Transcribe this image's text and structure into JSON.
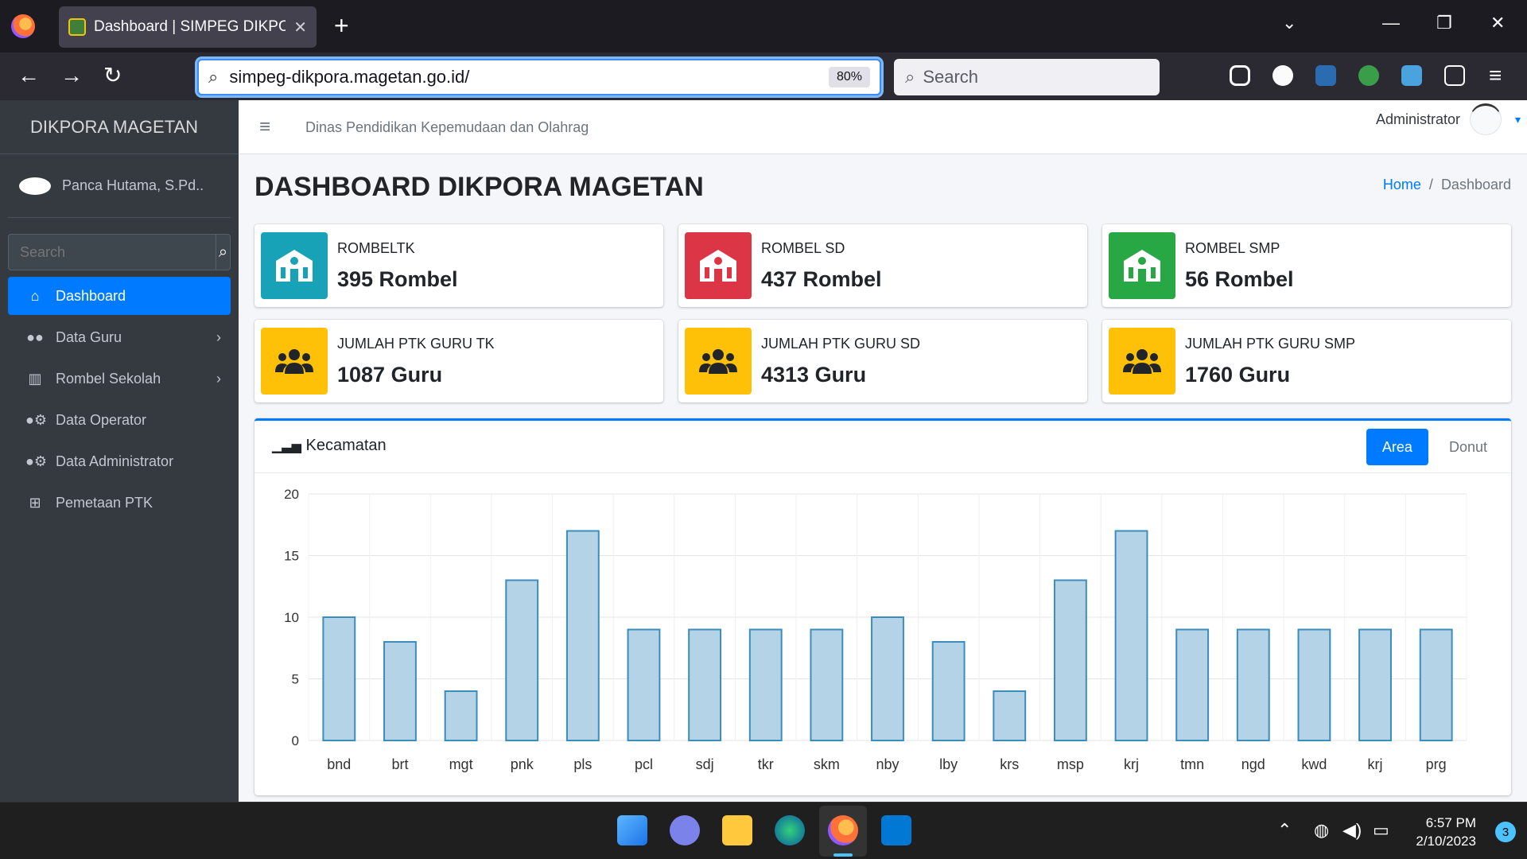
{
  "browser": {
    "tab_title": "Dashboard | SIMPEG DIKPORA",
    "url": "simpeg-dikpora.magetan.go.id/",
    "zoom": "80%",
    "search_placeholder": "Search"
  },
  "sidebar": {
    "brand": "DIKPORA MAGETAN",
    "user": "Panca Hutama, S.Pd..",
    "search_placeholder": "Search",
    "items": [
      {
        "label": "Dashboard",
        "icon": "home-icon",
        "active": true
      },
      {
        "label": "Data Guru",
        "icon": "users-icon",
        "submenu": true
      },
      {
        "label": "Rombel Sekolah",
        "icon": "school-icon",
        "submenu": true
      },
      {
        "label": "Data Operator",
        "icon": "users-cog-icon"
      },
      {
        "label": "Data Administrator",
        "icon": "users-cog-icon"
      },
      {
        "label": "Pemetaan PTK",
        "icon": "plus-square-icon"
      }
    ]
  },
  "topnav": {
    "title": "Dinas Pendidikan Kepemudaan dan Olahrag",
    "user": "Administrator"
  },
  "page": {
    "title": "DASHBOARD DIKPORA MAGETAN",
    "breadcrumb_home": "Home",
    "breadcrumb_current": "Dashboard"
  },
  "infoboxes": [
    {
      "label": "ROMBELTK",
      "value": "395 Rombel",
      "color": "#17a2b8",
      "icon": "school-icon"
    },
    {
      "label": "ROMBEL SD",
      "value": "437 Rombel",
      "color": "#dc3545",
      "icon": "school-icon"
    },
    {
      "label": "ROMBEL SMP",
      "value": "56 Rombel",
      "color": "#28a745",
      "icon": "school-icon"
    },
    {
      "label": "JUMLAH PTK GURU TK",
      "value": "1087 Guru",
      "color": "#ffc107",
      "icon": "users-icon"
    },
    {
      "label": "JUMLAH PTK GURU SD",
      "value": "4313 Guru",
      "color": "#ffc107",
      "icon": "users-icon"
    },
    {
      "label": "JUMLAH PTK GURU SMP",
      "value": "1760 Guru",
      "color": "#ffc107",
      "icon": "users-icon"
    }
  ],
  "card": {
    "title": "Kecamatan",
    "tab_area": "Area",
    "tab_donut": "Donut"
  },
  "chart_data": {
    "type": "bar",
    "title": "",
    "categories": [
      "bnd",
      "brt",
      "mgt",
      "pnk",
      "pls",
      "pcl",
      "sdj",
      "tkr",
      "skm",
      "nby",
      "lby",
      "krs",
      "msp",
      "krj",
      "tmn",
      "ngd",
      "kwd",
      "krj",
      "prg"
    ],
    "values": [
      10,
      8,
      4,
      13,
      17,
      9,
      9,
      9,
      9,
      10,
      8,
      4,
      13,
      17,
      9,
      9,
      9,
      9,
      9
    ],
    "ylim": [
      0,
      20
    ],
    "yticks": [
      0,
      5,
      10,
      15,
      20
    ],
    "grid": true,
    "bar_color": "#b5d3e7",
    "bar_border": "#3c8dbc"
  },
  "taskbar": {
    "time": "6:57 PM",
    "date": "2/10/2023",
    "notifications": "3"
  }
}
